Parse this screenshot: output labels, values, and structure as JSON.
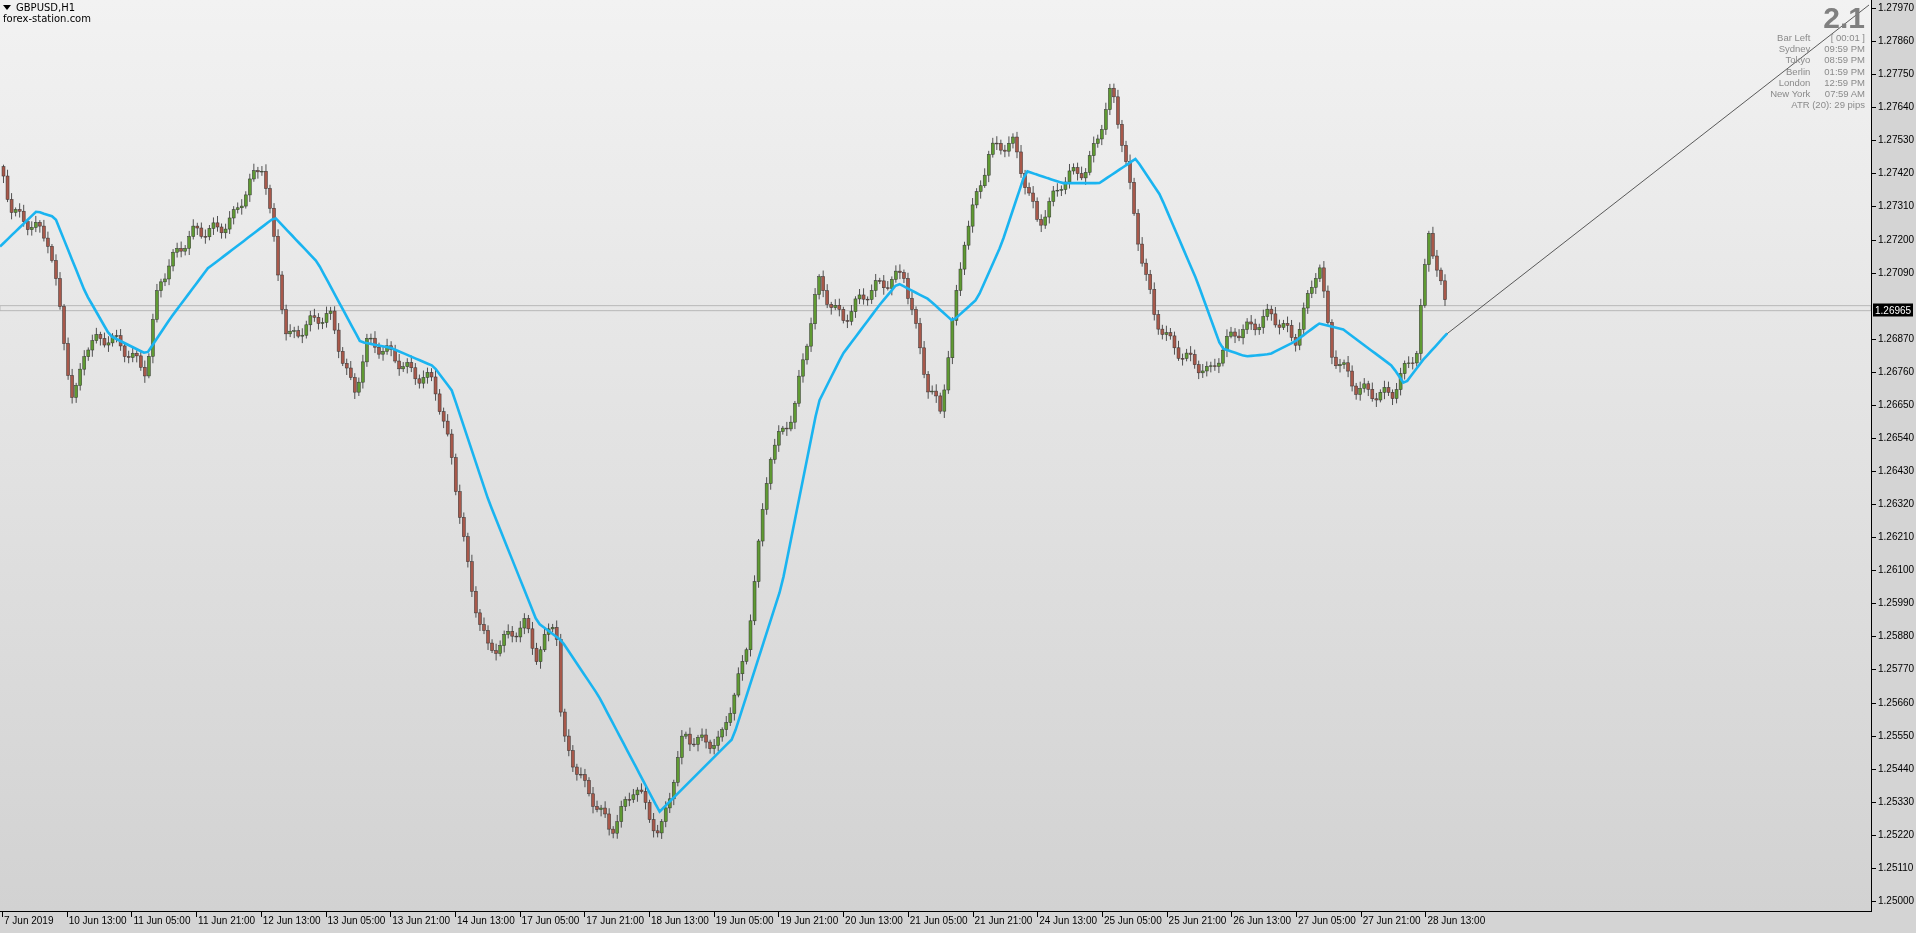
{
  "chart": {
    "symbol_title": "GBPUSD,H1",
    "source": "forex-station.com",
    "version": "2.1",
    "info_rows": [
      {
        "label": "Bar Left",
        "value": "[ 00:01 ]"
      },
      {
        "label": "Sydney",
        "value": "09:59 PM"
      },
      {
        "label": "Tokyo",
        "value": "08:59 PM"
      },
      {
        "label": "Berlin",
        "value": "01:59 PM"
      },
      {
        "label": "London",
        "value": "12:59 PM"
      },
      {
        "label": "New York",
        "value": "07:59 AM"
      }
    ],
    "atr": "ATR (20): 29 pips",
    "current_price": "1.26965"
  },
  "price_axis": {
    "upper_labels": [
      "1.27970",
      "1.27860",
      "1.27750",
      "1.27640",
      "1.27530",
      "1.27420",
      "1.27310",
      "1.27200",
      "1.27090"
    ],
    "lower_labels": [
      "1.26870",
      "1.26760",
      "1.26650",
      "1.26540",
      "1.26430",
      "1.26320",
      "1.26210",
      "1.26100",
      "1.25990",
      "1.25880",
      "1.25770",
      "1.25660",
      "1.25550",
      "1.25440",
      "1.25330",
      "1.25220",
      "1.25110",
      "1.25000"
    ]
  },
  "time_axis": {
    "labels": [
      "7 Jun 2019",
      "10 Jun 13:00",
      "11 Jun 05:00",
      "11 Jun 21:00",
      "12 Jun 13:00",
      "13 Jun 05:00",
      "13 Jun 21:00",
      "14 Jun 13:00",
      "17 Jun 05:00",
      "17 Jun 21:00",
      "18 Jun 13:00",
      "19 Jun 05:00",
      "19 Jun 21:00",
      "20 Jun 13:00",
      "21 Jun 05:00",
      "21 Jun 21:00",
      "24 Jun 13:00",
      "25 Jun 05:00",
      "25 Jun 21:00",
      "26 Jun 13:00",
      "27 Jun 05:00",
      "27 Jun 21:00",
      "28 Jun 13:00"
    ]
  }
}
